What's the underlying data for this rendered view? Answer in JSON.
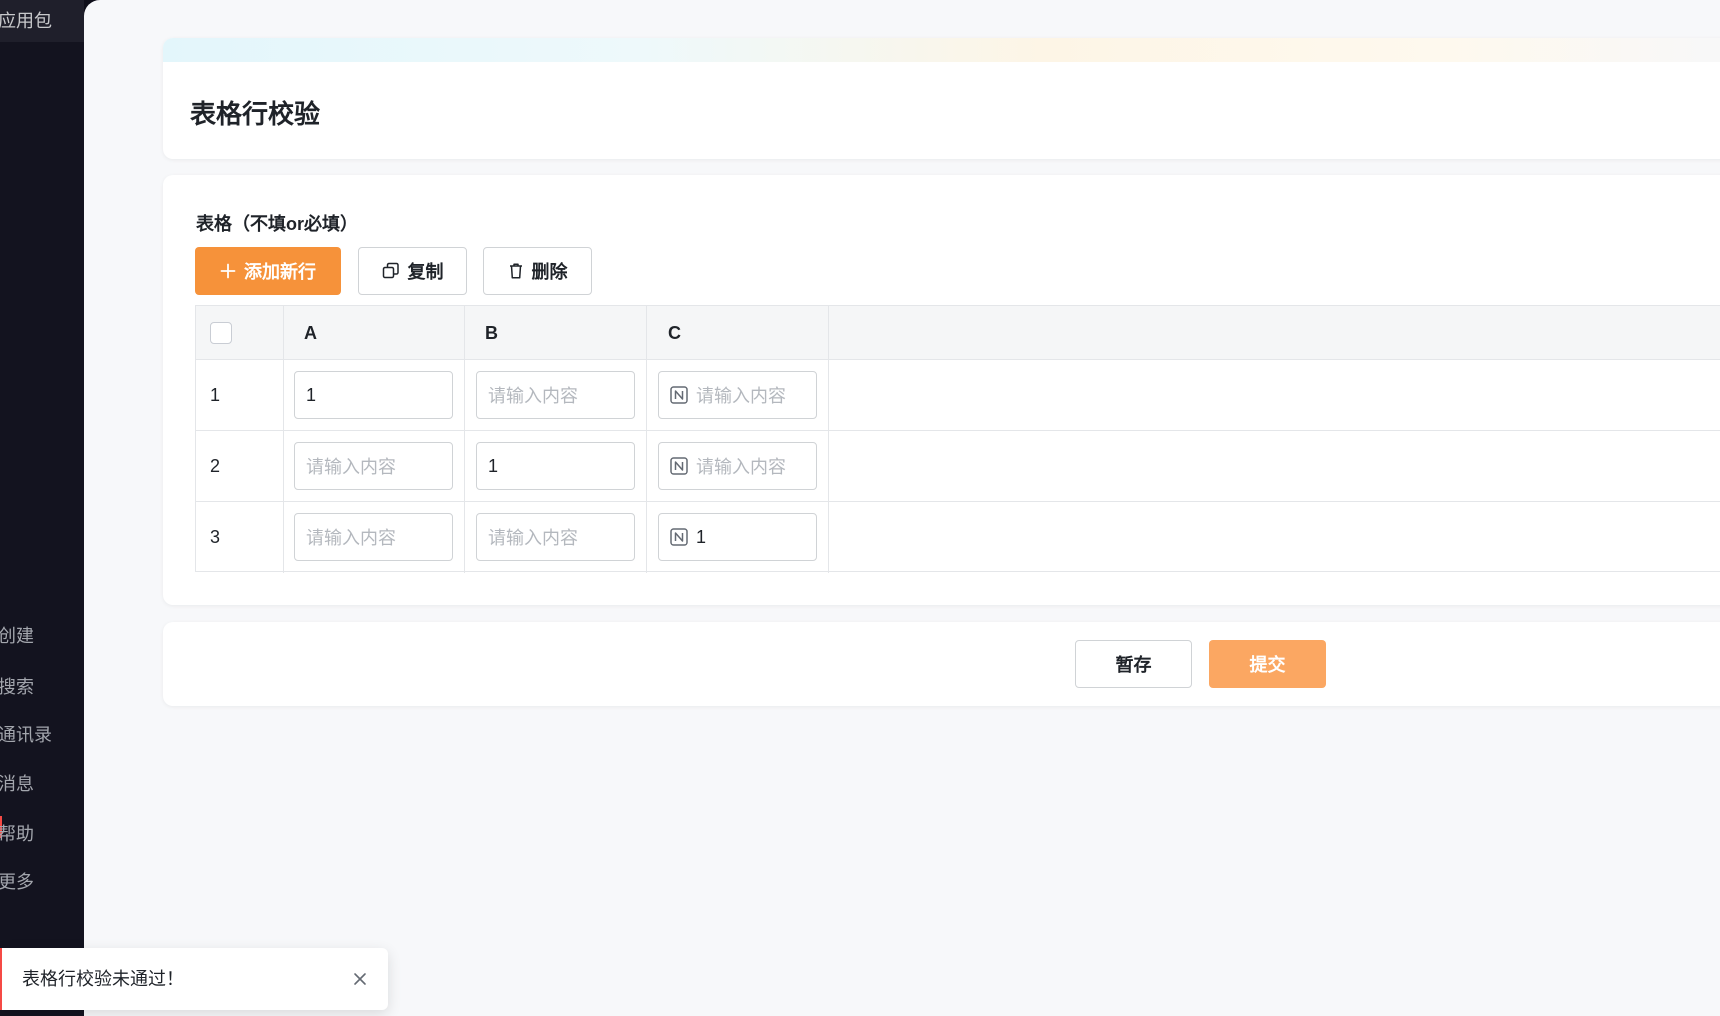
{
  "sidebar": {
    "top_item": "应用包",
    "items": [
      {
        "label": "创建"
      },
      {
        "label": "搜索"
      },
      {
        "label": "通讯录"
      },
      {
        "label": "消息"
      },
      {
        "label": "帮助"
      },
      {
        "label": "更多"
      }
    ]
  },
  "page": {
    "title": "表格行校验"
  },
  "form": {
    "field_label": "表格（不填or必填）",
    "toolbar": {
      "add_label": "添加新行",
      "copy_label": "复制",
      "delete_label": "删除"
    },
    "table": {
      "columns": [
        "A",
        "B",
        "C"
      ],
      "placeholder": "请输入内容",
      "rows": [
        {
          "index": "1",
          "a": "1",
          "b": "",
          "c": ""
        },
        {
          "index": "2",
          "a": "",
          "b": "1",
          "c": ""
        },
        {
          "index": "3",
          "a": "",
          "b": "",
          "c": "1"
        }
      ]
    }
  },
  "footer": {
    "save_label": "暂存",
    "submit_label": "提交"
  },
  "toast": {
    "message": "表格行校验未通过！"
  },
  "colors": {
    "accent": "#f6923a",
    "submit": "#fba762",
    "error": "#f54a45",
    "sidebar_bg": "#13131f"
  }
}
